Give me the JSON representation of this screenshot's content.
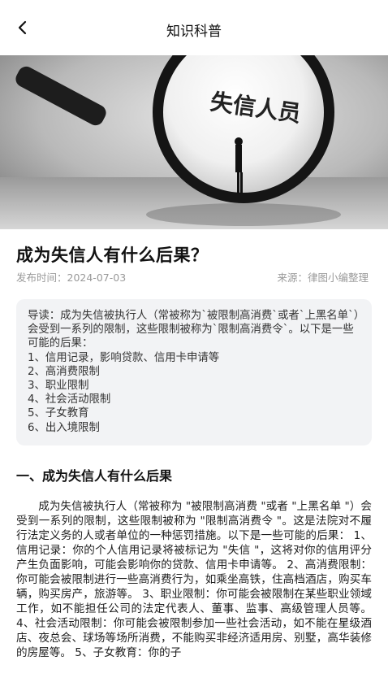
{
  "nav": {
    "title": "知识科普",
    "back_icon": "chevron-left-icon"
  },
  "hero": {
    "image_text": "失信人员"
  },
  "article": {
    "title": "成为失信人有什么后果？",
    "publish": "发布时间：2024-07-03",
    "source": "来源：律图小编整理"
  },
  "summary": {
    "intro": "导读：成为失信被执行人（常被称为`被限制高消费`或者`上黑名单`）会受到一系列的限制，这些限制被称为`限制高消费令`。以下是一些可能的后果：",
    "items": [
      "1、信用记录，影响贷款、信用卡申请等",
      "2、高消费限制",
      "3、职业限制",
      "4、社会活动限制",
      "5、子女教育",
      "6、出入境限制"
    ]
  },
  "section": {
    "title": "一、成为失信人有什么后果",
    "body": "成为失信被执行人（常被称为 \"被限制高消费 \"或者 \"上黑名单 \"）会受到一系列的限制，这些限制被称为 \"限制高消费令 \"。这是法院对不履行法定义务的人或者单位的一种惩罚措施。以下是一些可能的后果： 1、信用记录：你的个人信用记录将被标记为 \"失信 \"，这将对你的信用评分产生负面影响，可能会影响你的贷款、信用卡申请等。 2、高消费限制：你可能会被限制进行一些高消费行为，如乘坐高铁，住高档酒店，购买车辆，购买房产，旅游等。 3、职业限制：你可能会被限制在某些职业领域工作，如不能担任公司的法定代表人、董事、监事、高级管理人员等。 4、社会活动限制：你可能会被限制参加一些社会活动，如不能在星级酒店、夜总会、球场等场所消费，不能购买非经济适用房、别墅，高华装修的房屋等。 5、子女教育：你的子"
  }
}
